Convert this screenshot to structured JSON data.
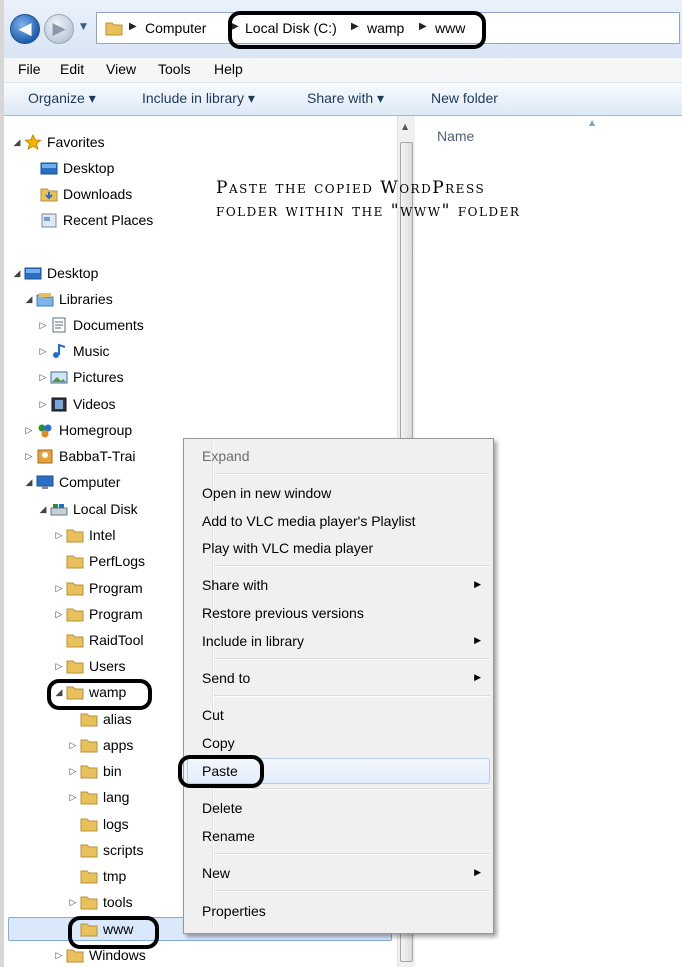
{
  "address_bar": {
    "crumbs": [
      "Computer",
      "Local Disk (C:)",
      "wamp",
      "www"
    ]
  },
  "menu_bar": [
    "File",
    "Edit",
    "View",
    "Tools",
    "Help"
  ],
  "command_bar": {
    "organize": "Organize ▾",
    "include_in_library": "Include in library ▾",
    "share_with": "Share with ▾",
    "new_folder": "New folder"
  },
  "nav_tree": [
    {
      "label": "Favorites",
      "icon": "star-icon"
    },
    {
      "label": "Desktop",
      "icon": "desktop-icon"
    },
    {
      "label": "Downloads",
      "icon": "downloads-icon"
    },
    {
      "label": "Recent Places",
      "icon": "recent-places-icon"
    },
    {
      "label": "Desktop",
      "icon": "desktop-icon"
    },
    {
      "label": "Libraries",
      "icon": "libraries-icon"
    },
    {
      "label": "Documents",
      "icon": "documents-icon"
    },
    {
      "label": "Music",
      "icon": "music-icon"
    },
    {
      "label": "Pictures",
      "icon": "pictures-icon"
    },
    {
      "label": "Videos",
      "icon": "videos-icon"
    },
    {
      "label": "Homegroup",
      "icon": "homegroup-icon"
    },
    {
      "label": "BabbaT-Trai",
      "icon": "user-icon"
    },
    {
      "label": "Computer",
      "icon": "computer-icon"
    },
    {
      "label": "Local Disk",
      "icon": "local-disk-icon"
    },
    {
      "label": "Intel",
      "icon": "folder-icon"
    },
    {
      "label": "PerfLogs",
      "icon": "folder-icon"
    },
    {
      "label": "Program",
      "icon": "folder-icon"
    },
    {
      "label": "Program",
      "icon": "folder-icon"
    },
    {
      "label": "RaidTool",
      "icon": "folder-icon"
    },
    {
      "label": "Users",
      "icon": "folder-icon"
    },
    {
      "label": "wamp",
      "icon": "folder-icon"
    },
    {
      "label": "alias",
      "icon": "folder-icon"
    },
    {
      "label": "apps",
      "icon": "folder-icon"
    },
    {
      "label": "bin",
      "icon": "folder-icon"
    },
    {
      "label": "lang",
      "icon": "folder-icon"
    },
    {
      "label": "logs",
      "icon": "folder-icon"
    },
    {
      "label": "scripts",
      "icon": "folder-icon"
    },
    {
      "label": "tmp",
      "icon": "folder-icon"
    },
    {
      "label": "tools",
      "icon": "folder-icon"
    },
    {
      "label": "www",
      "icon": "folder-icon"
    },
    {
      "label": "Windows",
      "icon": "folder-icon"
    }
  ],
  "content": {
    "column_name": "Name"
  },
  "annotation": {
    "line1": "Paste the copied WordPress",
    "line2": "folder within the \"www\" folder"
  },
  "context_menu": {
    "expand": "Expand",
    "open_new_window": "Open in new window",
    "add_vlc_playlist": "Add to VLC media player's Playlist",
    "play_vlc": "Play with VLC media player",
    "share_with": "Share with",
    "restore_previous": "Restore previous versions",
    "include_library": "Include in library",
    "send_to": "Send to",
    "cut": "Cut",
    "copy": "Copy",
    "paste": "Paste",
    "delete": "Delete",
    "rename": "Rename",
    "new": "New",
    "properties": "Properties"
  },
  "colors": {
    "folder": "#e8c15a",
    "selection": "#d9e8fb",
    "highlight_border": "#84acdd"
  }
}
